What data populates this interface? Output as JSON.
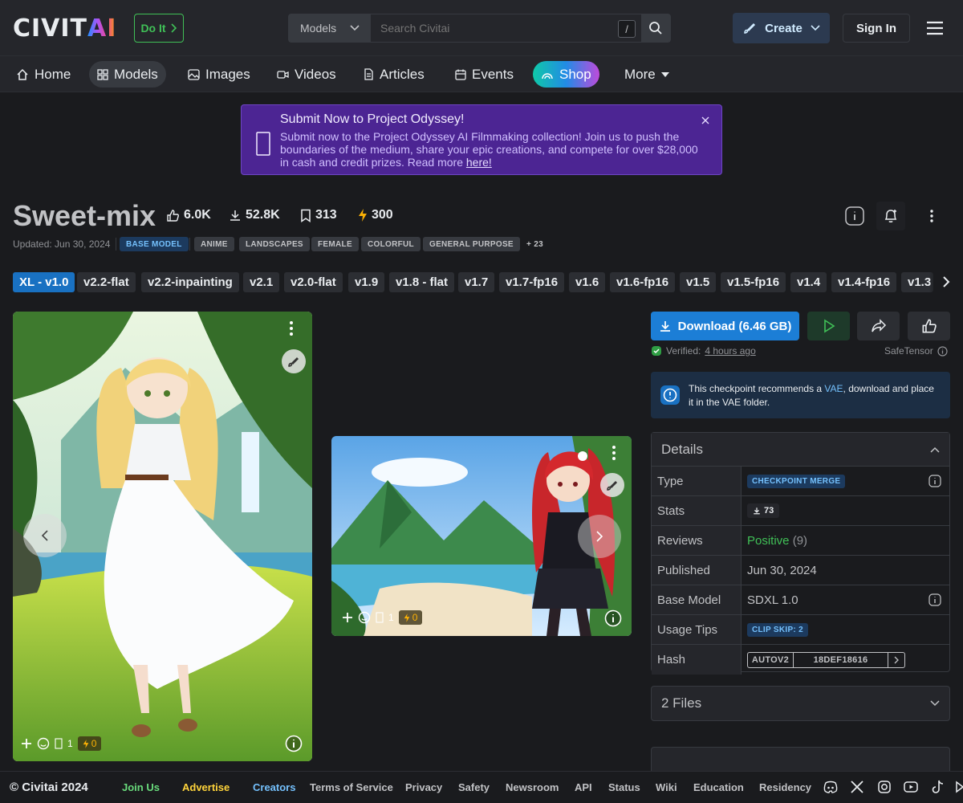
{
  "header": {
    "logo_left": "CIVIT",
    "logo_right": "AI",
    "doit_label": "Do It",
    "search_scope": "Models",
    "search_placeholder": "Search Civitai",
    "search_shortcut": "/",
    "create_label": "Create",
    "signin_label": "Sign In"
  },
  "nav": {
    "items": [
      {
        "label": "Home",
        "icon": "home-icon"
      },
      {
        "label": "Models",
        "icon": "grid-icon"
      },
      {
        "label": "Images",
        "icon": "photo-icon"
      },
      {
        "label": "Videos",
        "icon": "video-icon"
      },
      {
        "label": "Articles",
        "icon": "file-icon"
      },
      {
        "label": "Events",
        "icon": "calendar-icon"
      },
      {
        "label": "Shop",
        "icon": "rainbow-icon"
      },
      {
        "label": "More",
        "icon": "caret-down-icon"
      }
    ],
    "active": "Models"
  },
  "banner": {
    "title": "Submit Now to Project Odyssey!",
    "body": "Submit now to the Project Odyssey AI Filmmaking collection! Join us to push the boundaries of the medium, share your epic creations, and compete for over $28,000 in cash and credit prizes. Read more",
    "link": "here!"
  },
  "model": {
    "name": "Sweet-mix",
    "likes": "6.0K",
    "downloads": "52.8K",
    "bookmarks": "313",
    "buzz": "300",
    "updated": "Updated: Jun 30, 2024",
    "tags": [
      "BASE MODEL",
      "ANIME",
      "LANDSCAPES",
      "FEMALE",
      "COLORFUL",
      "GENERAL PURPOSE"
    ],
    "more_tags": "+ 23"
  },
  "versions": [
    "XL - v1.0",
    "v2.2-flat",
    "v2.2-inpainting",
    "v2.1",
    "v2.0-flat",
    "v1.9",
    "v1.8 - flat",
    "v1.7",
    "v1.7-fp16",
    "v1.6",
    "v1.6-fp16",
    "v1.5",
    "v1.5-fp16",
    "v1.4",
    "v1.4-fp16",
    "v1.3"
  ],
  "gallery": [
    {
      "comments": "1",
      "buzz": "0"
    },
    {
      "comments": "1",
      "buzz": "0"
    }
  ],
  "download": {
    "label": "Download (6.46 GB)",
    "verified_label": "Verified:",
    "verified_time": "4 hours ago",
    "format": "SafeTensor"
  },
  "vae_notice": {
    "pre": "This checkpoint recommends a ",
    "link": "VAE",
    "post": ", download and place it in the VAE folder."
  },
  "details": {
    "title": "Details",
    "rows": [
      {
        "key": "Type",
        "value": "CHECKPOINT MERGE"
      },
      {
        "key": "Stats",
        "value": "73"
      },
      {
        "key": "Reviews",
        "value": "Positive",
        "extra": "(9)"
      },
      {
        "key": "Published",
        "value": "Jun 30, 2024"
      },
      {
        "key": "Base Model",
        "value": "SDXL 1.0"
      },
      {
        "key": "Usage Tips",
        "value": "CLIP SKIP: 2"
      },
      {
        "key": "Hash",
        "value": "AUTOV2",
        "extra": "18DEF18616"
      }
    ]
  },
  "files": {
    "label": "2 Files"
  },
  "footer": {
    "copyright": "© Civitai 2024",
    "links": [
      "Join Us",
      "Advertise",
      "Creators",
      "Terms of Service",
      "Privacy",
      "Safety",
      "Newsroom",
      "API",
      "Status",
      "Wiki",
      "Education",
      "Residency"
    ]
  },
  "colors": {
    "accent": "#1c7ed6",
    "banner": "#4c2593",
    "positive": "#40c057",
    "buzz": "#fab005"
  }
}
